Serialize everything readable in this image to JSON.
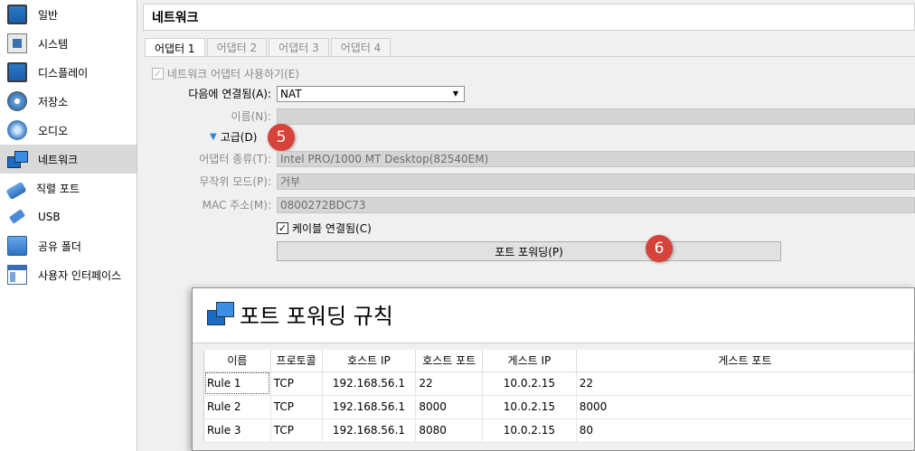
{
  "sidebar": {
    "items": [
      {
        "label": "일반",
        "icon": "general-monitor-icon"
      },
      {
        "label": "시스템",
        "icon": "system-chip-icon"
      },
      {
        "label": "디스플레이",
        "icon": "display-monitor-icon"
      },
      {
        "label": "저장소",
        "icon": "storage-disk-icon"
      },
      {
        "label": "오디오",
        "icon": "audio-speaker-icon"
      },
      {
        "label": "네트워크",
        "icon": "network-icon"
      },
      {
        "label": "직렬 포트",
        "icon": "serial-port-icon"
      },
      {
        "label": "USB",
        "icon": "usb-icon"
      },
      {
        "label": "공유 폴더",
        "icon": "shared-folder-icon"
      },
      {
        "label": "사용자 인터페이스",
        "icon": "user-interface-icon"
      }
    ],
    "active_index": 5
  },
  "main": {
    "title": "네트워크",
    "tabs": [
      "어댑터 1",
      "어댑터 2",
      "어댑터 3",
      "어댑터 4"
    ],
    "enable_adapter_label": "네트워크 어댑터 사용하기(E)",
    "attached_to_label": "다음에 연결됨(A):",
    "attached_to_value": "NAT",
    "name_label": "이름(N):",
    "advanced_label": "고급(D)",
    "adapter_type_label": "어댑터 종류(T):",
    "adapter_type_value": "Intel PRO/1000 MT Desktop(82540EM)",
    "promiscuous_label": "무작위 모드(P):",
    "promiscuous_value": "거부",
    "mac_label": "MAC 주소(M):",
    "mac_value": "0800272BDC73",
    "cable_connected_label": "케이블 연결됨(C)",
    "port_forwarding_button": "포트 포워딩(P)",
    "badge_advanced": "5",
    "badge_port_forwarding": "6"
  },
  "dialog": {
    "title": "포트 포워딩 규칙",
    "columns": [
      "이름",
      "프로토콜",
      "호스트 IP",
      "호스트 포트",
      "게스트 IP",
      "게스트 포트"
    ],
    "rows": [
      [
        "Rule 1",
        "TCP",
        "192.168.56.1",
        "22",
        "10.0.2.15",
        "22"
      ],
      [
        "Rule 2",
        "TCP",
        "192.168.56.1",
        "8000",
        "10.0.2.15",
        "8000"
      ],
      [
        "Rule 3",
        "TCP",
        "192.168.56.1",
        "8080",
        "10.0.2.15",
        "80"
      ]
    ]
  },
  "colors": {
    "badge": "#d6433b",
    "accent": "#1a6bc5"
  }
}
